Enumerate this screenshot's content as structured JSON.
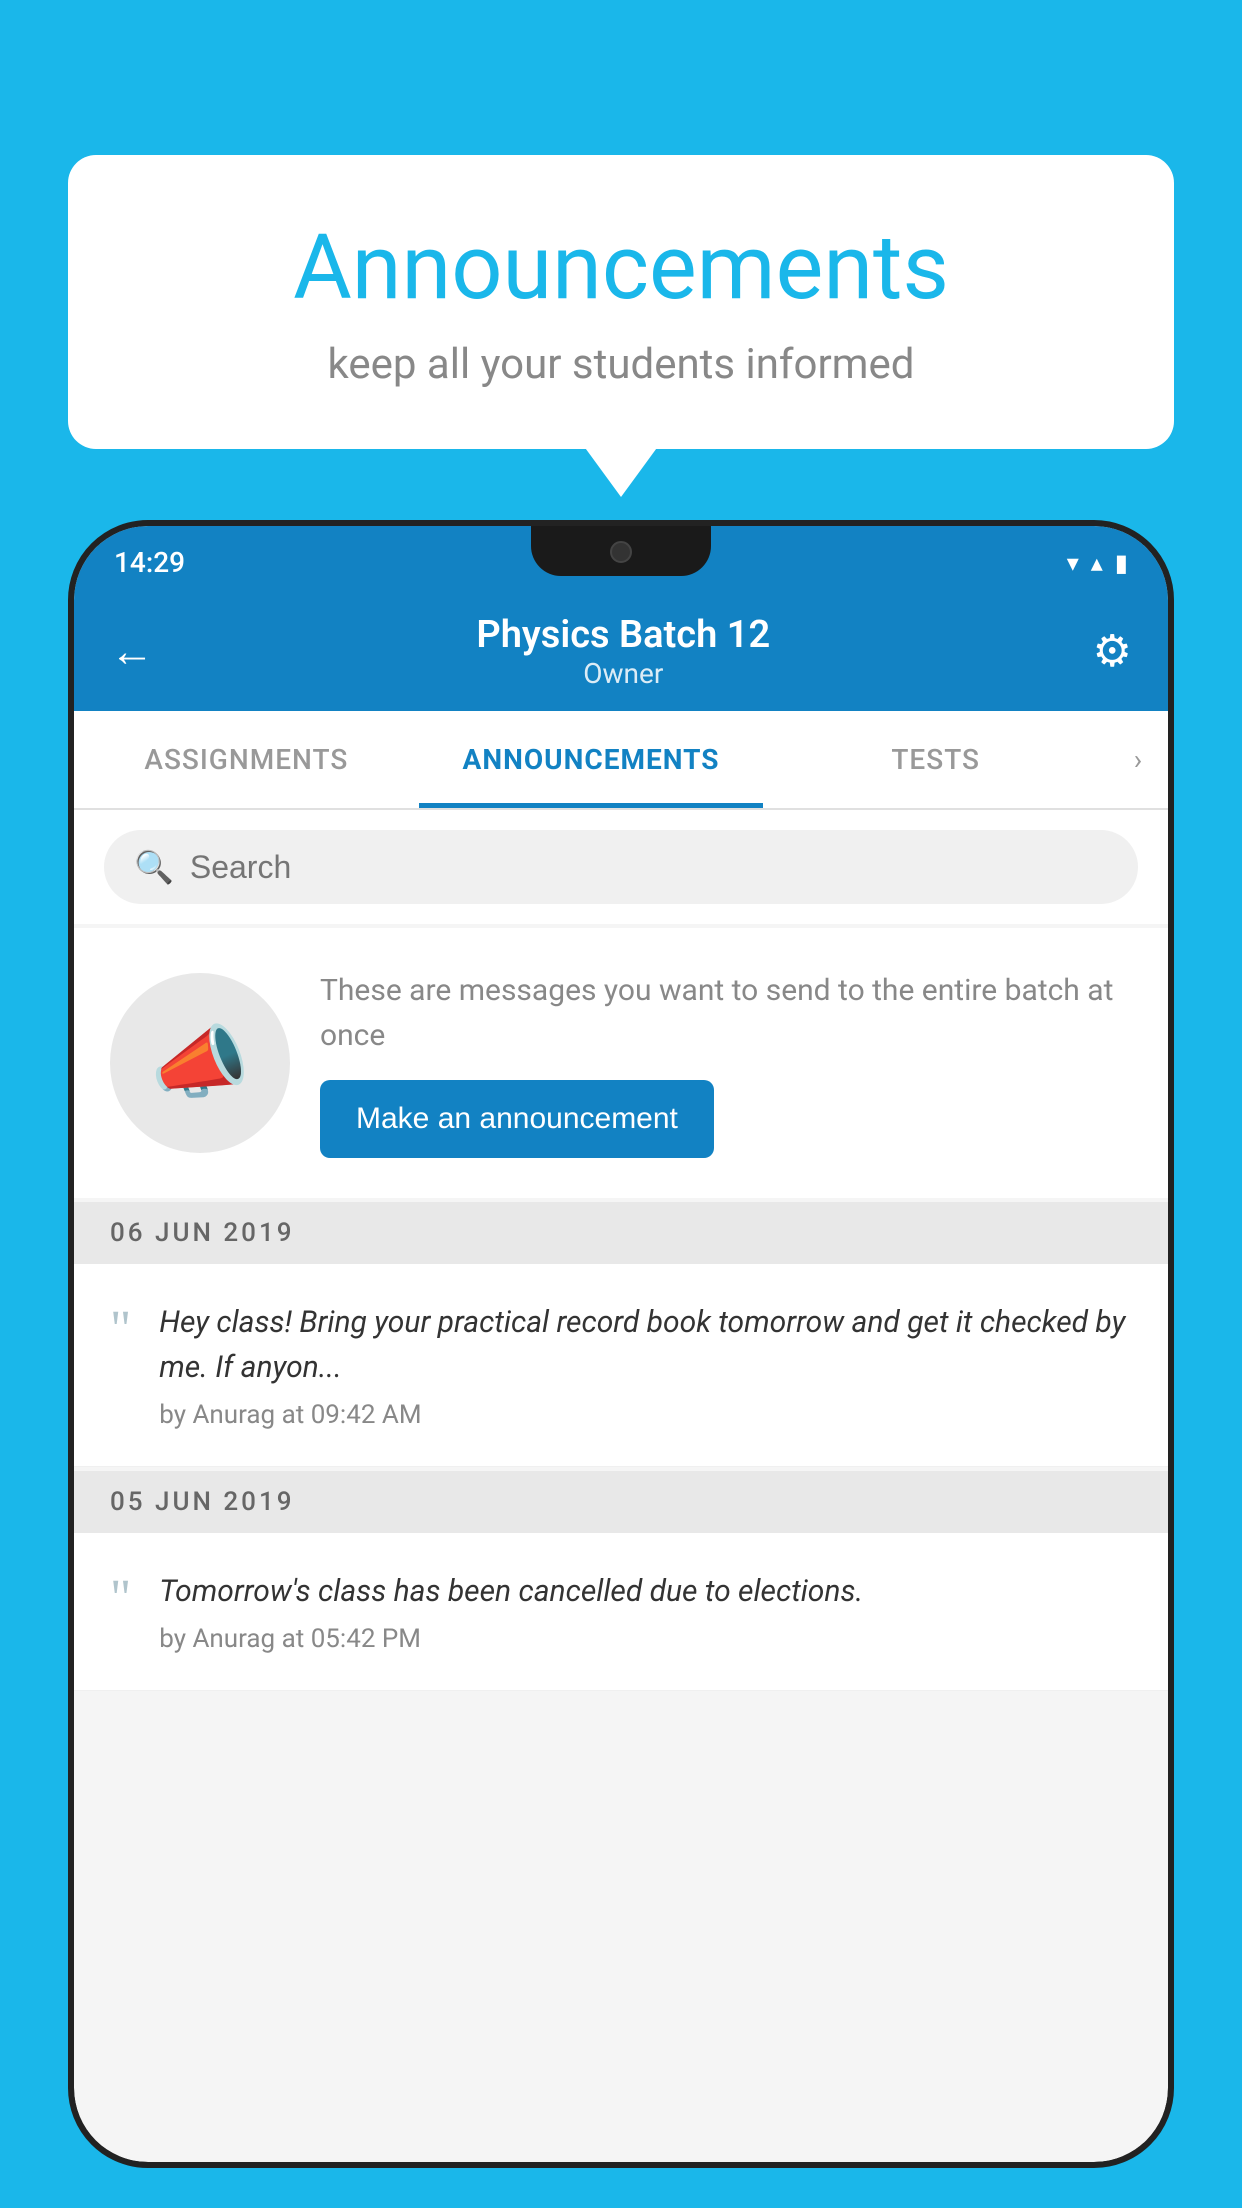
{
  "background_color": "#1ab7ea",
  "speech_bubble": {
    "title": "Announcements",
    "subtitle": "keep all your students informed"
  },
  "phone": {
    "status_bar": {
      "time": "14:29",
      "wifi": "▼",
      "signal": "▲",
      "battery": "▌"
    },
    "app_bar": {
      "title": "Physics Batch 12",
      "subtitle": "Owner",
      "back_label": "←",
      "settings_label": "⚙"
    },
    "tabs": [
      {
        "label": "ASSIGNMENTS",
        "active": false
      },
      {
        "label": "ANNOUNCEMENTS",
        "active": true
      },
      {
        "label": "TESTS",
        "active": false
      }
    ],
    "search": {
      "placeholder": "Search"
    },
    "promo": {
      "description": "These are messages you want to\nsend to the entire batch at once",
      "button_label": "Make an announcement"
    },
    "announcements": [
      {
        "date": "06  JUN  2019",
        "message_text": "Hey class! Bring your practical record book tomorrow and get it checked by me. If anyon...",
        "author": "by Anurag at 09:42 AM"
      },
      {
        "date": "05  JUN  2019",
        "message_text": "Tomorrow's class has been cancelled due to elections.",
        "author": "by Anurag at 05:42 PM"
      }
    ]
  }
}
